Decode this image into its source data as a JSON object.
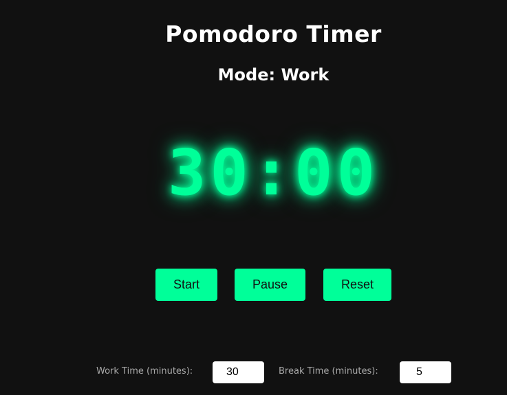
{
  "app": {
    "title": "Pomodoro Timer",
    "mode_text": "Mode: Work",
    "timer_display": "30:00",
    "accent_color": "#00ff99",
    "background_color": "#111111"
  },
  "controls": {
    "start_label": "Start",
    "pause_label": "Pause",
    "reset_label": "Reset"
  },
  "settings": {
    "work_label": "Work Time (minutes):",
    "work_value": "30",
    "break_label": "Break Time (minutes):",
    "break_value": "5"
  }
}
